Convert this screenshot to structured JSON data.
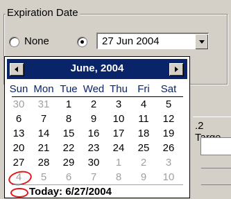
{
  "group": {
    "title": "Expiration Date"
  },
  "options": {
    "none_label": "None",
    "date_value": "27 Jun 2004"
  },
  "background": {
    "tab_fragment": ".2 Targe"
  },
  "calendar": {
    "month_title": "June, 2004",
    "weekdays": [
      "Sun",
      "Mon",
      "Tue",
      "Wed",
      "Thu",
      "Fri",
      "Sat"
    ],
    "weeks": [
      [
        {
          "d": "30",
          "other": true
        },
        {
          "d": "31",
          "other": true
        },
        {
          "d": "1"
        },
        {
          "d": "2"
        },
        {
          "d": "3"
        },
        {
          "d": "4"
        },
        {
          "d": "5"
        }
      ],
      [
        {
          "d": "6"
        },
        {
          "d": "7"
        },
        {
          "d": "8"
        },
        {
          "d": "9"
        },
        {
          "d": "10"
        },
        {
          "d": "11"
        },
        {
          "d": "12"
        }
      ],
      [
        {
          "d": "13"
        },
        {
          "d": "14"
        },
        {
          "d": "15"
        },
        {
          "d": "16"
        },
        {
          "d": "17"
        },
        {
          "d": "18"
        },
        {
          "d": "19"
        }
      ],
      [
        {
          "d": "20"
        },
        {
          "d": "21"
        },
        {
          "d": "22"
        },
        {
          "d": "23"
        },
        {
          "d": "24"
        },
        {
          "d": "25"
        },
        {
          "d": "26"
        }
      ],
      [
        {
          "d": "27",
          "selected": true
        },
        {
          "d": "28"
        },
        {
          "d": "29"
        },
        {
          "d": "30"
        },
        {
          "d": "1",
          "other": true
        },
        {
          "d": "2",
          "other": true
        },
        {
          "d": "3",
          "other": true
        }
      ],
      [
        {
          "d": "4",
          "other": true
        },
        {
          "d": "5",
          "other": true
        },
        {
          "d": "6",
          "other": true
        },
        {
          "d": "7",
          "other": true
        },
        {
          "d": "8",
          "other": true
        },
        {
          "d": "9",
          "other": true
        },
        {
          "d": "10",
          "other": true
        }
      ]
    ],
    "today_label": "Today: 6/27/2004"
  },
  "colors": {
    "header_bg": "#0a246a",
    "today_circle": "#e01818",
    "dialog_bg": "#d4d0c8"
  }
}
